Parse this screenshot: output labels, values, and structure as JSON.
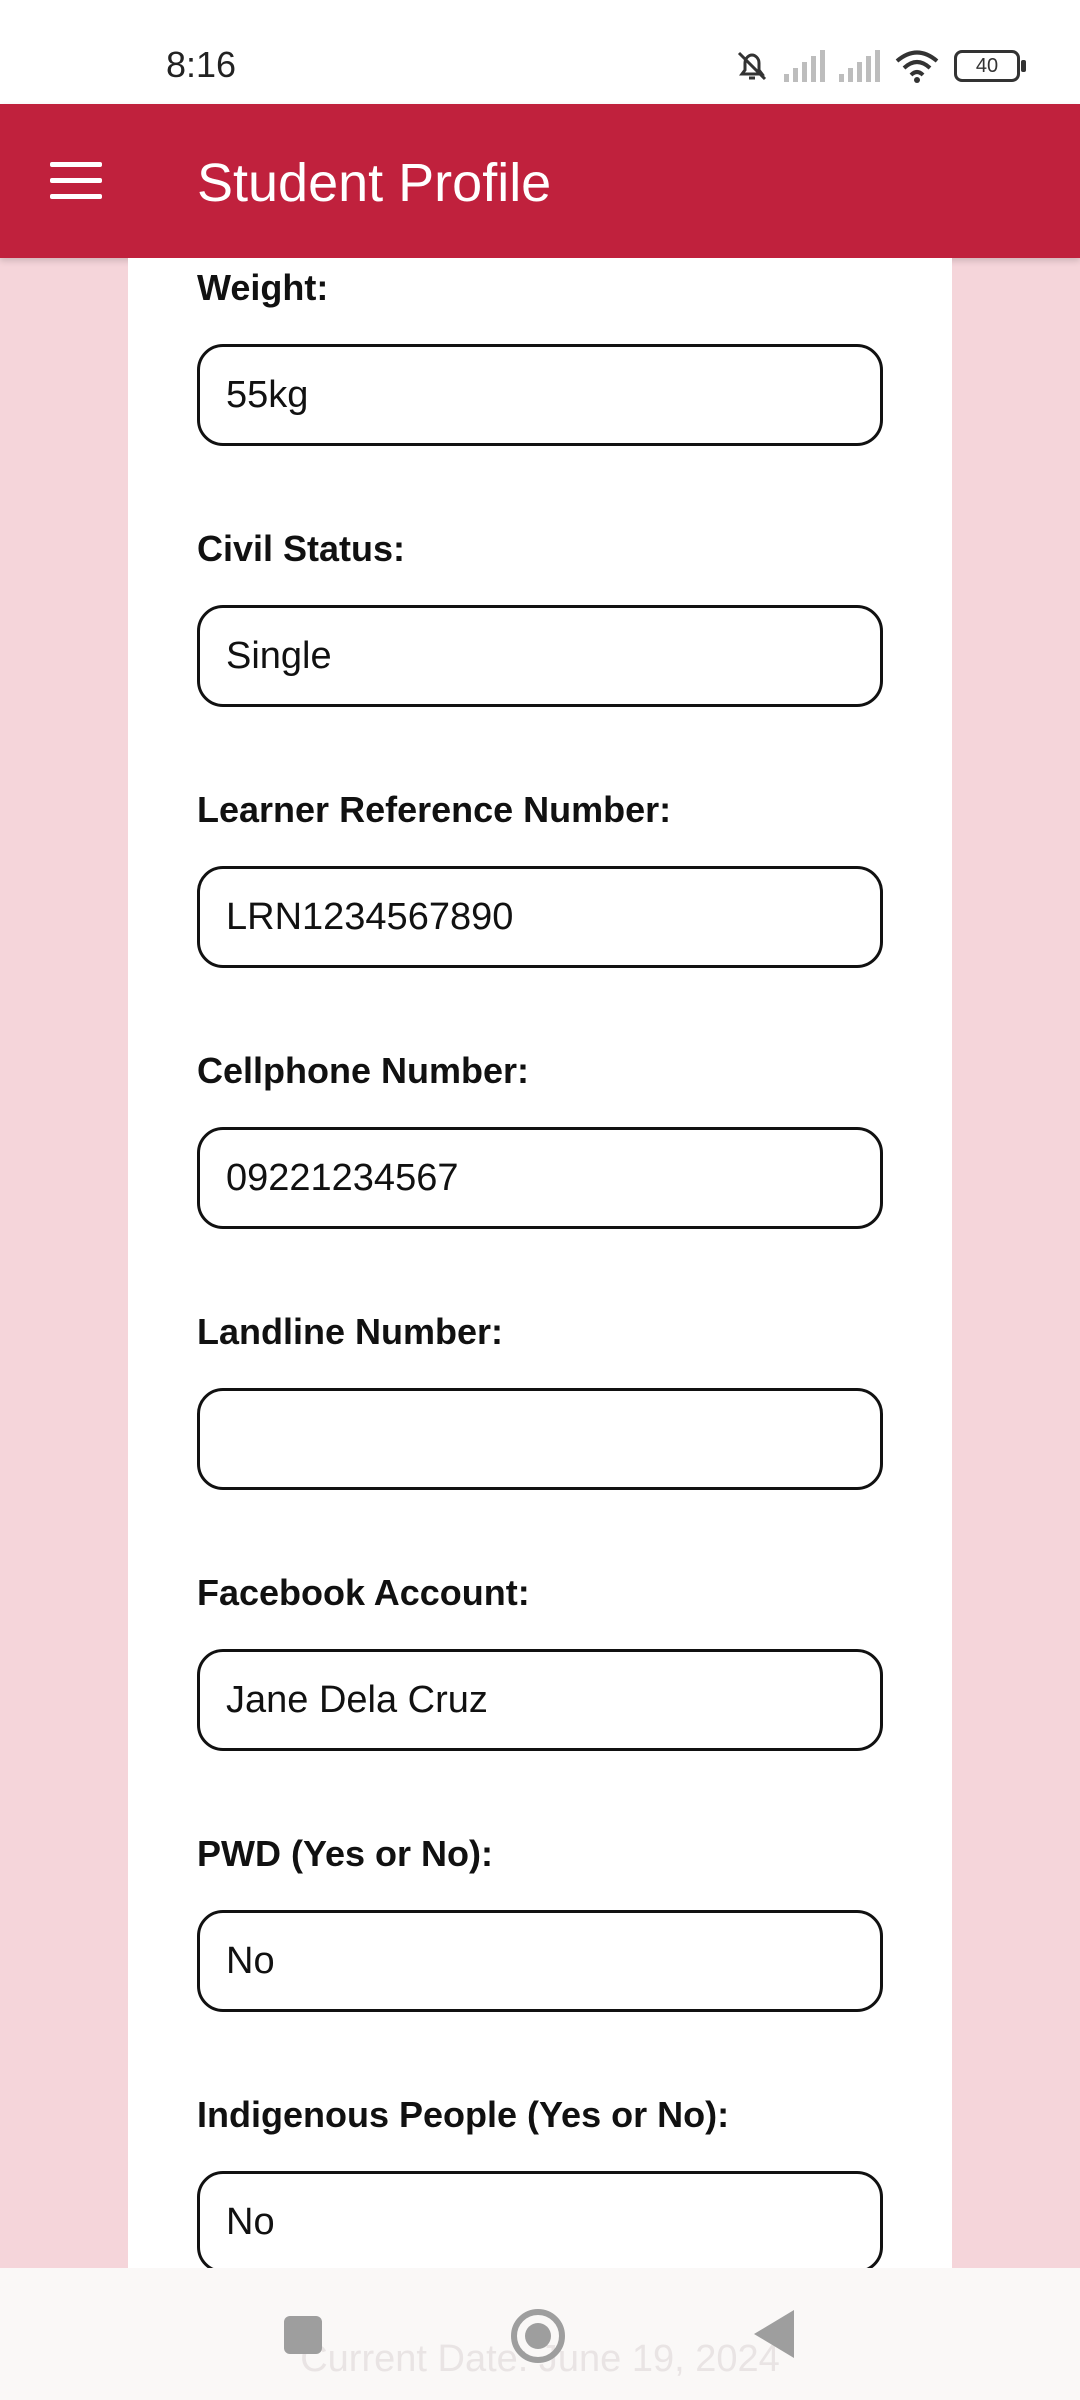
{
  "status": {
    "time": "8:16",
    "battery": "40"
  },
  "app_bar": {
    "title": "Student Profile"
  },
  "fields": [
    {
      "label": "Weight:",
      "value": "55kg"
    },
    {
      "label": "Civil Status:",
      "value": "Single"
    },
    {
      "label": "Learner Reference Number:",
      "value": "LRN1234567890"
    },
    {
      "label": "Cellphone Number:",
      "value": "09221234567"
    },
    {
      "label": "Landline Number:",
      "value": ""
    },
    {
      "label": "Facebook Account:",
      "value": "Jane Dela Cruz"
    },
    {
      "label": "PWD (Yes or No):",
      "value": "No"
    },
    {
      "label": "Indigenous People (Yes or No):",
      "value": "No"
    }
  ],
  "footer": {
    "current_date": "Current Date: June 19, 2024"
  },
  "colors": {
    "accent": "#c0213d",
    "page_bg": "#f5d5da"
  }
}
